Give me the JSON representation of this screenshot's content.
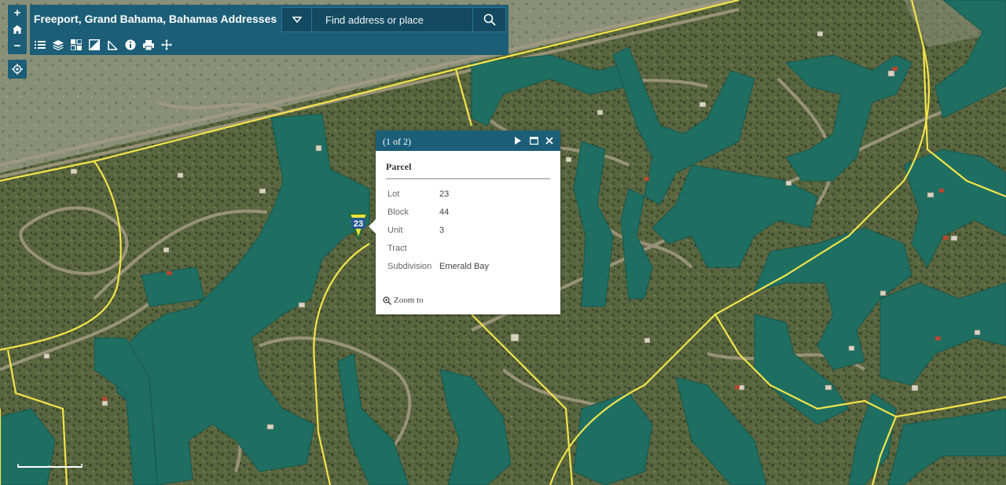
{
  "app": {
    "title": "Freeport, Grand Bahama, Bahamas Addresses"
  },
  "search": {
    "placeholder": "Find address or place"
  },
  "map_controls": {
    "zoom_in": "+",
    "zoom_out": "−"
  },
  "toolbar": {
    "tools": [
      "list-icon",
      "layers-icon",
      "basemap-gallery-icon",
      "overview-map-icon",
      "measure-icon",
      "info-icon",
      "print-icon",
      "pan-icon"
    ]
  },
  "marker": {
    "label": "23"
  },
  "popup": {
    "count": "(1 of 2)",
    "layer_title": "Parcel",
    "fields": [
      {
        "name": "Lot",
        "value": "23"
      },
      {
        "name": "Block",
        "value": "44"
      },
      {
        "name": "Unit",
        "value": "3"
      },
      {
        "name": "Tract",
        "value": ""
      },
      {
        "name": "Subdivision",
        "value": "Emerald Bay"
      }
    ],
    "zoom_label": "Zoom to"
  },
  "colors": {
    "brand": "#1c5e78",
    "parcel_line": "#f2e44a",
    "canal": "#1f6e62"
  }
}
